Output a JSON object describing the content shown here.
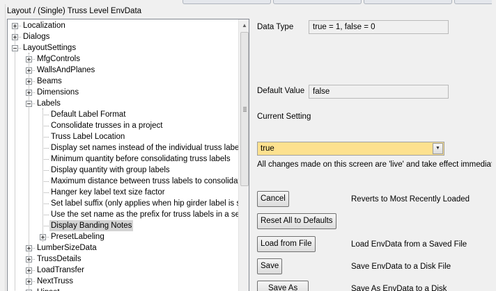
{
  "header": {
    "title": "Layout / (Single) Truss Level EnvData"
  },
  "tree": {
    "items": [
      {
        "label": "Localization",
        "level": 0,
        "expander": "plus"
      },
      {
        "label": "Dialogs",
        "level": 0,
        "expander": "plus"
      },
      {
        "label": "LayoutSettings",
        "level": 0,
        "expander": "minus"
      },
      {
        "label": "MfgControls",
        "level": 1,
        "expander": "plus"
      },
      {
        "label": "WallsAndPlanes",
        "level": 1,
        "expander": "plus"
      },
      {
        "label": "Beams",
        "level": 1,
        "expander": "plus"
      },
      {
        "label": "Dimensions",
        "level": 1,
        "expander": "plus"
      },
      {
        "label": "Labels",
        "level": 1,
        "expander": "minus"
      },
      {
        "label": "Default Label Format",
        "level": 2,
        "expander": "none"
      },
      {
        "label": "Consolidate trusses in a project",
        "level": 2,
        "expander": "none"
      },
      {
        "label": "Truss Label Location",
        "level": 2,
        "expander": "none"
      },
      {
        "label": "Display set names instead of the individual truss labels",
        "level": 2,
        "expander": "none"
      },
      {
        "label": "Minimum quantity before consolidating truss labels",
        "level": 2,
        "expander": "none"
      },
      {
        "label": "Display quantity with group labels",
        "level": 2,
        "expander": "none"
      },
      {
        "label": "Maximum distance between truss labels to consolidate",
        "level": 2,
        "expander": "none"
      },
      {
        "label": "Hanger key label text size factor",
        "level": 2,
        "expander": "none"
      },
      {
        "label": "Set label suffix (only applies when hip girder label is set r",
        "level": 2,
        "expander": "none"
      },
      {
        "label": "Use the set name as the prefix for truss labels in a set",
        "level": 2,
        "expander": "none"
      },
      {
        "label": "Display Banding Notes",
        "level": 2,
        "expander": "none",
        "selected": true
      },
      {
        "label": "PresetLabeling",
        "level": 2,
        "expander": "plus"
      },
      {
        "label": "LumberSizeData",
        "level": 1,
        "expander": "plus"
      },
      {
        "label": "TrussDetails",
        "level": 1,
        "expander": "plus"
      },
      {
        "label": "LoadTransfer",
        "level": 1,
        "expander": "plus"
      },
      {
        "label": "NextTruss",
        "level": 1,
        "expander": "plus"
      },
      {
        "label": "Hipset",
        "level": 1,
        "expander": "plus"
      }
    ]
  },
  "details": {
    "data_type_label": "Data Type",
    "data_type_value": "true = 1, false = 0",
    "default_value_label": "Default Value",
    "default_value": "false",
    "current_setting_label": "Current Setting",
    "current_value": "true",
    "live_note": "All changes made on this screen are 'live' and take effect immediately."
  },
  "actions": {
    "cancel_label": "Cancel",
    "cancel_desc": "Reverts to Most Recently Loaded",
    "reset_label": "Reset All to Defaults",
    "load_label": "Load from File",
    "load_desc": "Load EnvData from a Saved File",
    "save_label": "Save",
    "save_desc": "Save EnvData to a Disk File",
    "save_as_label": "Save As",
    "save_as_desc": "Save As EnvData to a Disk"
  },
  "colors": {
    "current_value_bg": "#fde18f",
    "selected_bg": "#d3d3d3"
  }
}
